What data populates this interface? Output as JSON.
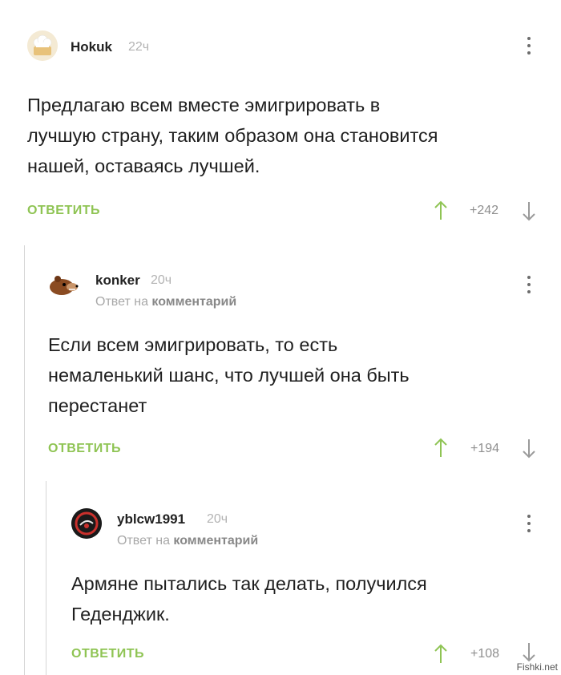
{
  "comments": [
    {
      "username": "Hokuk",
      "time": "22ч",
      "text_lines": [
        "Предлагаю всем вместе эмигрировать в",
        "лучшую страну, таким образом она становится",
        "нашей, оставаясь лучшей."
      ],
      "reply_label": "ОТВЕТИТЬ",
      "score": "+242",
      "avatar_icon": "chef-hat-avatar-icon"
    },
    {
      "username": "konker",
      "time": "20ч",
      "reply_to_prefix": "Ответ на",
      "reply_to_target": "комментарий",
      "text_lines": [
        "Если всем эмигрировать, то есть",
        "немаленький шанс, что лучшей она быть",
        "перестанет"
      ],
      "reply_label": "ОТВЕТИТЬ",
      "score": "+194",
      "avatar_icon": "bear-avatar-icon"
    },
    {
      "username": "yblcw1991",
      "time": "20ч",
      "reply_to_prefix": "Ответ на",
      "reply_to_target": "комментарий",
      "text_lines": [
        "Армяне пытались так делать, получился",
        "Геденджик."
      ],
      "reply_label": "ОТВЕТИТЬ",
      "score": "+108",
      "avatar_icon": "badge-avatar-icon"
    }
  ],
  "watermark": "Fishki.net",
  "colors": {
    "accent": "#8fc454",
    "arrow": "#8fc454",
    "muted": "#b3b3b3"
  }
}
